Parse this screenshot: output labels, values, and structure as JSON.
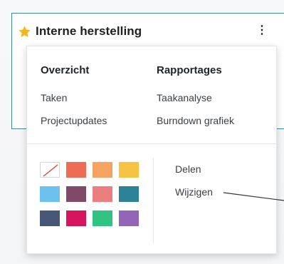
{
  "card": {
    "title": "Interne herstelling",
    "star_icon": "star-icon",
    "star_color": "#f3b61f",
    "menu_icon": "kebab-menu-icon",
    "menu_glyph": "⋮"
  },
  "dropdown": {
    "overview": {
      "heading": "Overzicht",
      "items": [
        "Taken",
        "Projectupdates"
      ]
    },
    "reports": {
      "heading": "Rapportages",
      "items": [
        "Taakanalyse",
        "Burndown grafiek"
      ]
    },
    "colors": [
      {
        "name": "no-color",
        "hex": "#ffffff"
      },
      {
        "name": "red",
        "hex": "#ee6b55"
      },
      {
        "name": "orange",
        "hex": "#f4a460"
      },
      {
        "name": "yellow",
        "hex": "#f6c342"
      },
      {
        "name": "light-blue",
        "hex": "#6cc1ed"
      },
      {
        "name": "dark-purple",
        "hex": "#814968"
      },
      {
        "name": "salmon-pink",
        "hex": "#eb7e7f"
      },
      {
        "name": "teal",
        "hex": "#2c8397"
      },
      {
        "name": "dark-blue",
        "hex": "#475577"
      },
      {
        "name": "fuchsia",
        "hex": "#d6145f"
      },
      {
        "name": "green",
        "hex": "#30c381"
      },
      {
        "name": "purple",
        "hex": "#9365b8"
      }
    ],
    "actions": [
      "Delen",
      "Wijzigen"
    ]
  }
}
